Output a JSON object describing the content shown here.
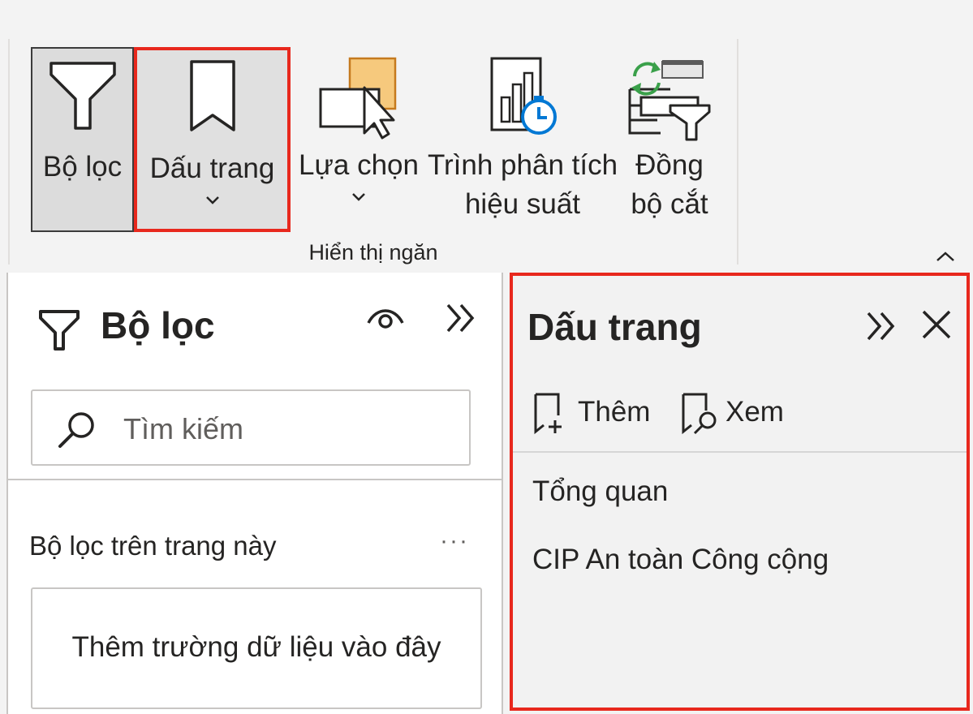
{
  "ribbon": {
    "buttons": [
      {
        "label": "Bộ lọc",
        "icon": "filter-icon"
      },
      {
        "label": "Dấu trang",
        "icon": "bookmark-icon",
        "has_dropdown": true,
        "highlighted": true
      },
      {
        "label": "Lựa chọn",
        "icon": "selection-icon",
        "has_dropdown": true
      },
      {
        "label_line1": "Trình phân tích",
        "label_line2": "hiệu suất",
        "icon": "performance-analyzer-icon"
      },
      {
        "label_line1": "Đồng",
        "label_line2": "bộ cắt",
        "icon": "sync-slicers-icon"
      }
    ],
    "group_label": "Hiển thị ngăn"
  },
  "filters_pane": {
    "title": "Bộ lọc",
    "search_placeholder": "Tìm kiếm",
    "section_title": "Bộ lọc trên trang này",
    "more_label": "···",
    "dropzone_text": "Thêm trường dữ liệu vào đây"
  },
  "bookmarks_pane": {
    "title": "Dấu trang",
    "add_label": "Thêm",
    "view_label": "Xem",
    "items": [
      "Tổng quan",
      "CIP An toàn Công cộng"
    ]
  },
  "colors": {
    "highlight": "#e8281d",
    "ribbon_bg": "#f3f3f3",
    "pane_bg": "#ffffff",
    "bookmarks_bg": "#f2f2f2",
    "accent_blue": "#0078d4",
    "sync_green": "#3aa04a"
  }
}
